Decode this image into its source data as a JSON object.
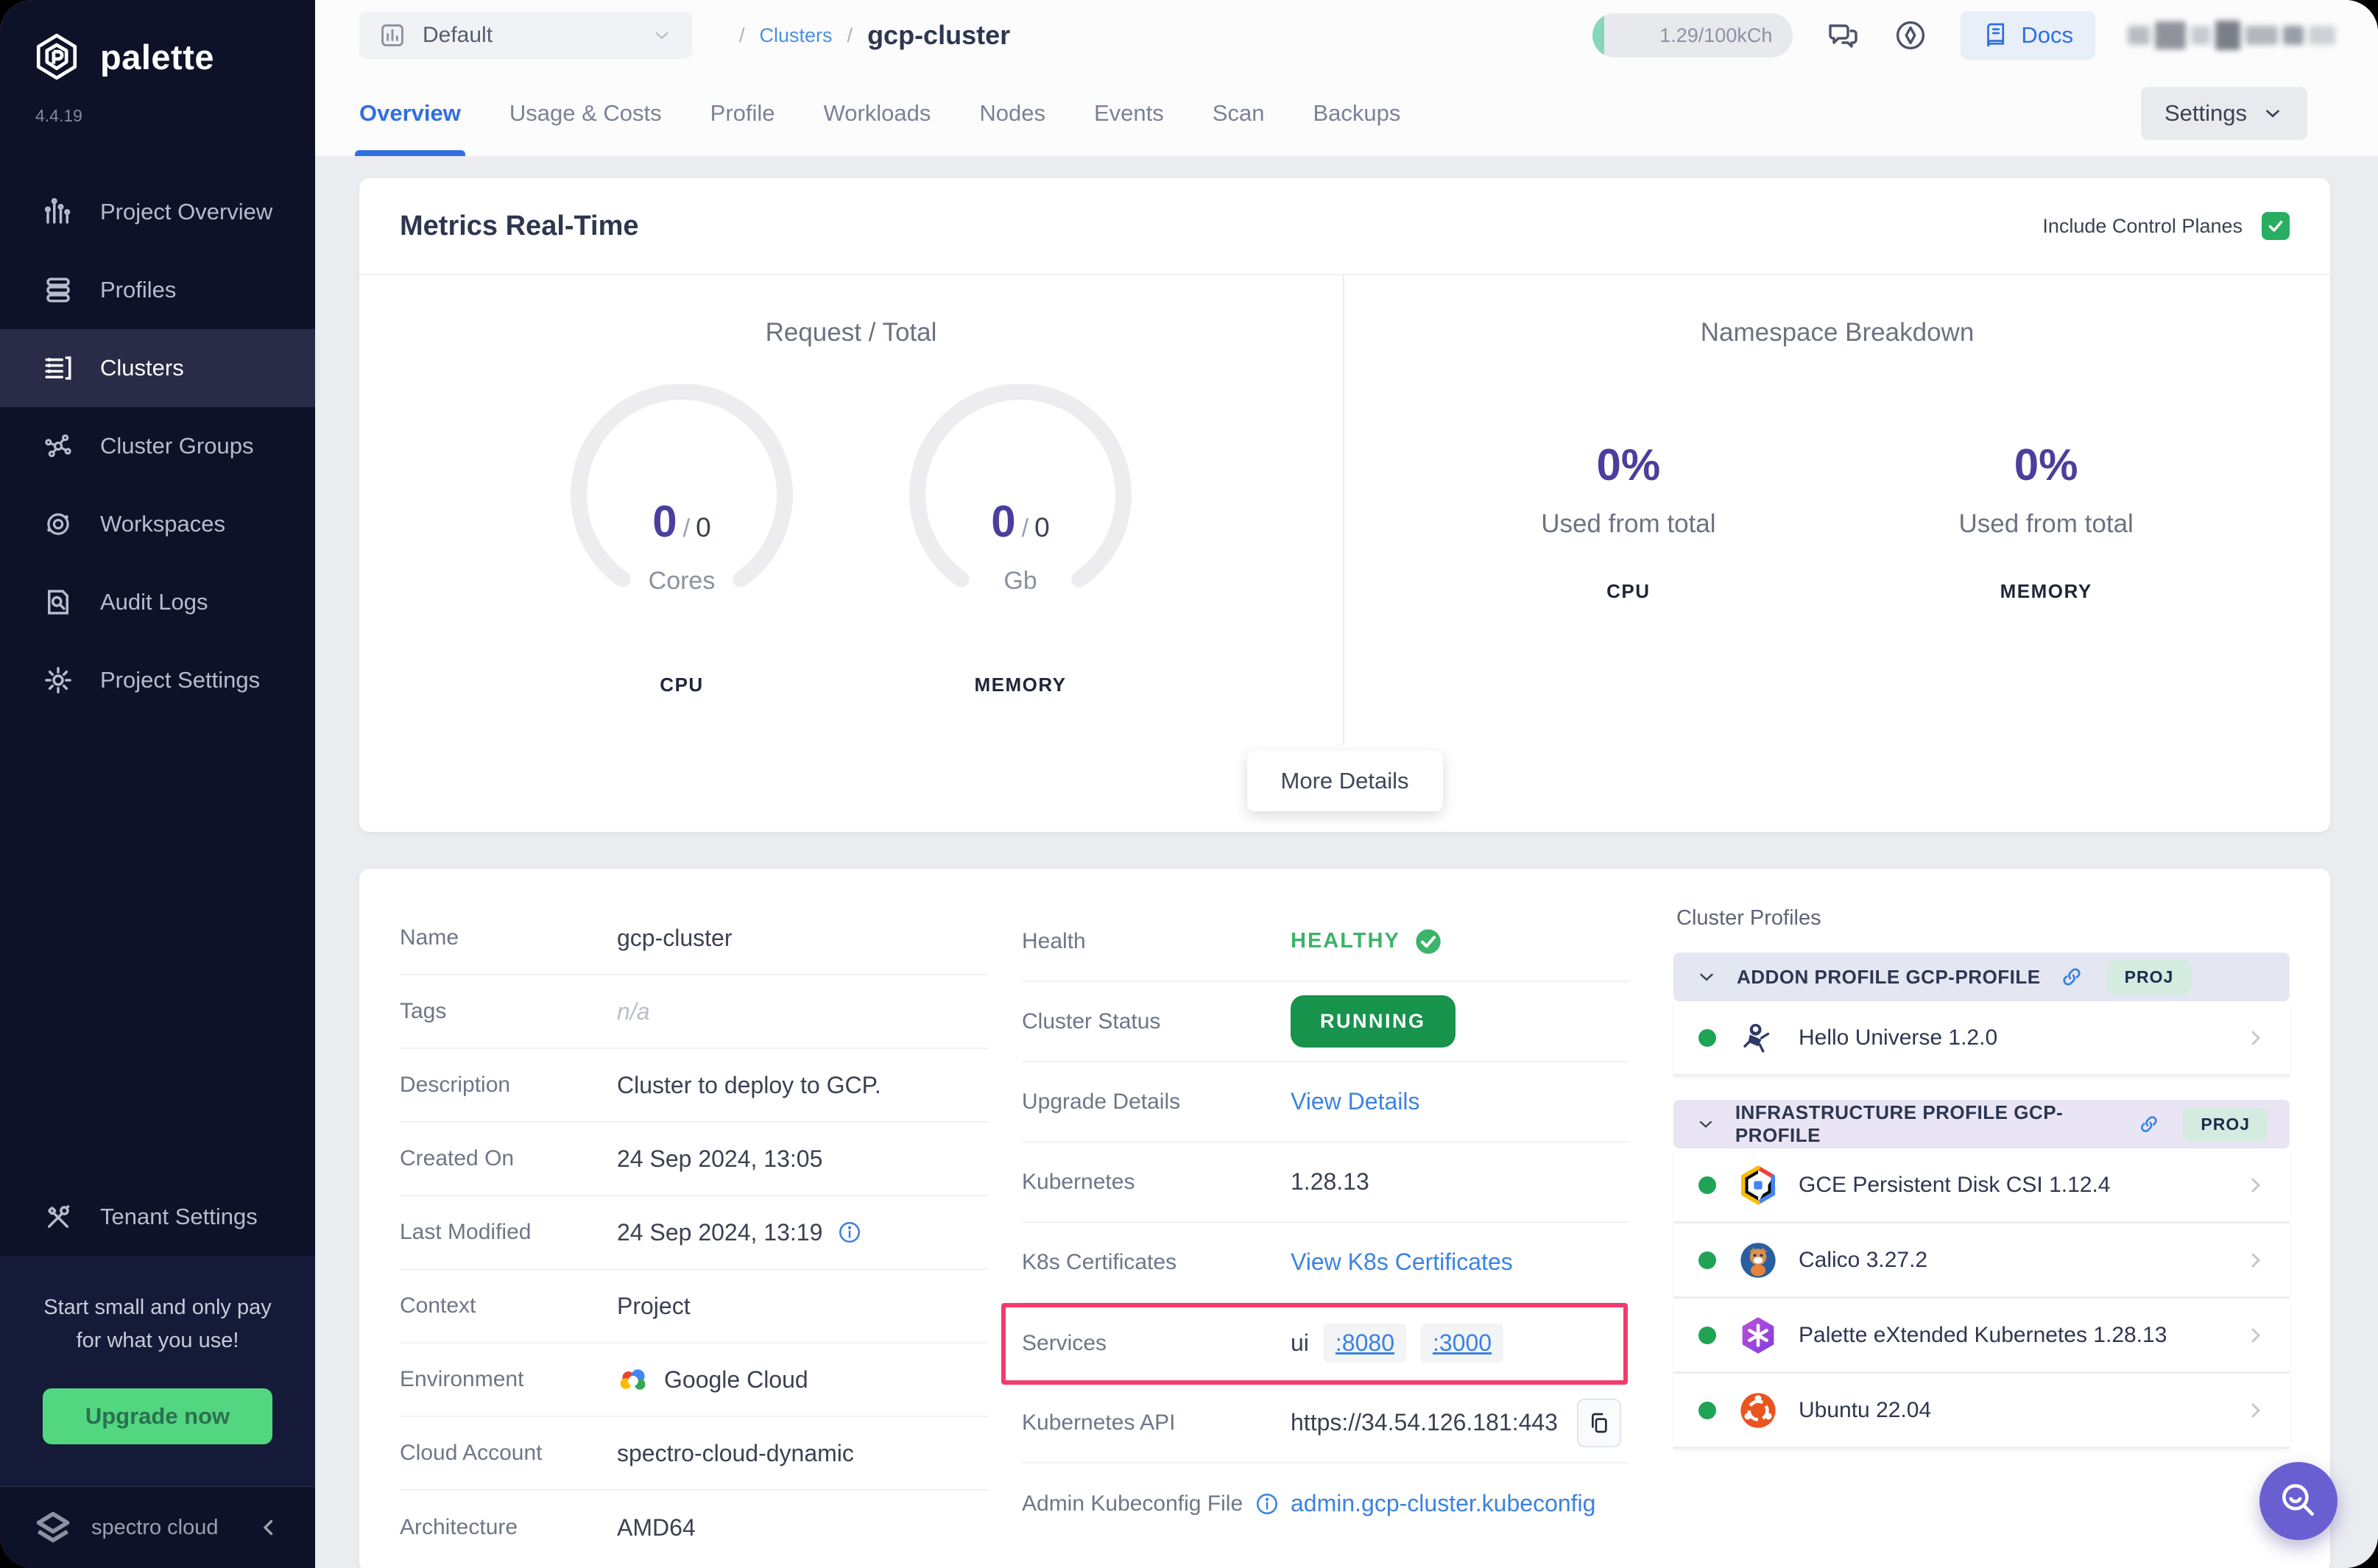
{
  "sidebar": {
    "logo_text": "palette",
    "version": "4.4.19",
    "items": [
      {
        "icon": "bar-chart-icon",
        "label": "Project Overview"
      },
      {
        "icon": "layers-icon",
        "label": "Profiles"
      },
      {
        "icon": "server-icon",
        "label": "Clusters"
      },
      {
        "icon": "network-icon",
        "label": "Cluster Groups"
      },
      {
        "icon": "orbit-icon",
        "label": "Workspaces"
      },
      {
        "icon": "audit-icon",
        "label": "Audit Logs"
      },
      {
        "icon": "gear-icon",
        "label": "Project Settings"
      }
    ],
    "active_item": "Clusters",
    "tenant_label": "Tenant Settings",
    "promo_line1": "Start small and only pay",
    "promo_line2": "for what you use!",
    "upgrade_label": "Upgrade now",
    "brand_name": "spectro cloud"
  },
  "topbar": {
    "selector_label": "Default",
    "breadcrumb_sep": "/",
    "breadcrumb_parent": "Clusters",
    "breadcrumb_current": "gcp-cluster",
    "usage_text": "1.29/100kCh",
    "docs_label": "Docs"
  },
  "tabsbar": {
    "tabs": [
      {
        "label": "Overview"
      },
      {
        "label": "Usage & Costs"
      },
      {
        "label": "Profile"
      },
      {
        "label": "Workloads"
      },
      {
        "label": "Nodes"
      },
      {
        "label": "Events"
      },
      {
        "label": "Scan"
      },
      {
        "label": "Backups"
      }
    ],
    "active_tab": "Overview",
    "settings_label": "Settings"
  },
  "metrics": {
    "title": "Metrics Real-Time",
    "include_label": "Include Control Planes",
    "include_checked": true,
    "request_title": "Request / Total",
    "gauges": [
      {
        "value": "0",
        "sep": "/",
        "total": "0",
        "unit": "Cores",
        "label": "CPU"
      },
      {
        "value": "0",
        "sep": "/",
        "total": "0",
        "unit": "Gb",
        "label": "MEMORY"
      }
    ],
    "namespace_title": "Namespace Breakdown",
    "stats": [
      {
        "percent": "0%",
        "caption": "Used from total",
        "label": "CPU"
      },
      {
        "percent": "0%",
        "caption": "Used from total",
        "label": "MEMORY"
      }
    ],
    "more_label": "More Details"
  },
  "details": {
    "rows": [
      {
        "label": "Name",
        "value": "gcp-cluster"
      },
      {
        "label": "Tags",
        "value": "n/a"
      },
      {
        "label": "Description",
        "value": "Cluster to deploy to GCP."
      },
      {
        "label": "Created On",
        "value": "24 Sep 2024, 13:05"
      },
      {
        "label": "Last Modified",
        "value": "24 Sep 2024, 13:19"
      },
      {
        "label": "Context",
        "value": "Project"
      },
      {
        "label": "Environment",
        "value": "Google Cloud"
      },
      {
        "label": "Cloud Account",
        "value": "spectro-cloud-dynamic"
      },
      {
        "label": "Architecture",
        "value": "AMD64"
      }
    ],
    "middle": {
      "health_label": "Health",
      "health_value": "HEALTHY",
      "status_label": "Cluster Status",
      "status_value": "RUNNING",
      "upgrade_label": "Upgrade Details",
      "upgrade_link": "View Details",
      "kubernetes_label": "Kubernetes",
      "kubernetes_value": "1.28.13",
      "certs_label": "K8s Certificates",
      "certs_link": "View K8s Certificates",
      "services_label": "Services",
      "services_name": "ui",
      "ports": [
        ":8080",
        ":3000"
      ],
      "api_label": "Kubernetes API",
      "api_value": "https://34.54.126.181:443",
      "kubeconfig_label": "Admin Kubeconfig File",
      "kubeconfig_link": "admin.gcp-cluster.kubeconfig"
    },
    "profiles": {
      "heading": "Cluster Profiles",
      "sections": [
        {
          "title": "ADDON PROFILE GCP-PROFILE",
          "badge": "PROJ",
          "items": [
            {
              "icon": "hello-universe-icon",
              "name": "Hello Universe 1.2.0"
            }
          ]
        },
        {
          "title": "INFRASTRUCTURE PROFILE GCP-PROFILE",
          "badge": "PROJ",
          "items": [
            {
              "icon": "gce-disk-icon",
              "name": "GCE Persistent Disk CSI 1.12.4"
            },
            {
              "icon": "calico-icon",
              "name": "Calico 3.27.2"
            },
            {
              "icon": "pxk-icon",
              "name": "Palette eXtended Kubernetes 1.28.13"
            },
            {
              "icon": "ubuntu-icon",
              "name": "Ubuntu 22.04"
            }
          ]
        }
      ]
    }
  },
  "colors": {
    "sidebar_navy": "#0e1228",
    "accent_blue": "#2f6fe0",
    "link_blue": "#3b82e0",
    "stat_purple": "#4a3f9c",
    "healthy_green": "#3cb36a",
    "running_green": "#17934c",
    "checkbox_green": "#27ae60",
    "dot_green": "#21a356",
    "highlight_pink": "#f23b6e",
    "upgrade_green": "#53d680",
    "fab_purple": "#6a5fd1"
  }
}
